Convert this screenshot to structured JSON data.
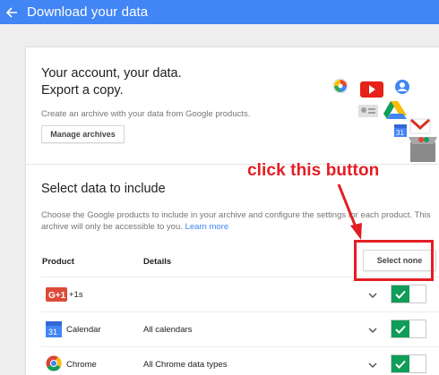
{
  "header": {
    "title": "Download your data",
    "back_icon": "arrow-back-icon"
  },
  "account": {
    "title_line1": "Your account, your data.",
    "title_line2": "Export a copy.",
    "subtitle": "Create an archive with your data from Google products.",
    "manage_button": "Manage archives"
  },
  "select_section": {
    "title": "Select data to include",
    "description": "Choose the Google products to include in your archive and configure the settings for each product. This archive will only be accessible to you.",
    "learn_more": "Learn more",
    "col_product": "Product",
    "col_details": "Details",
    "select_none_button": "Select none"
  },
  "products": [
    {
      "name": "+1s",
      "details": "",
      "icon": "google-plus-icon",
      "enabled": true
    },
    {
      "name": "Calendar",
      "details": "All calendars",
      "icon": "calendar-icon",
      "enabled": true
    },
    {
      "name": "Chrome",
      "details": "All Chrome data types",
      "icon": "chrome-icon",
      "enabled": true
    }
  ],
  "annotation": {
    "text": "click this button"
  },
  "colors": {
    "appbar": "#4285f4",
    "toggle_on": "#0f9d58",
    "annotation_red": "#e31e24",
    "link": "#4285f4"
  }
}
